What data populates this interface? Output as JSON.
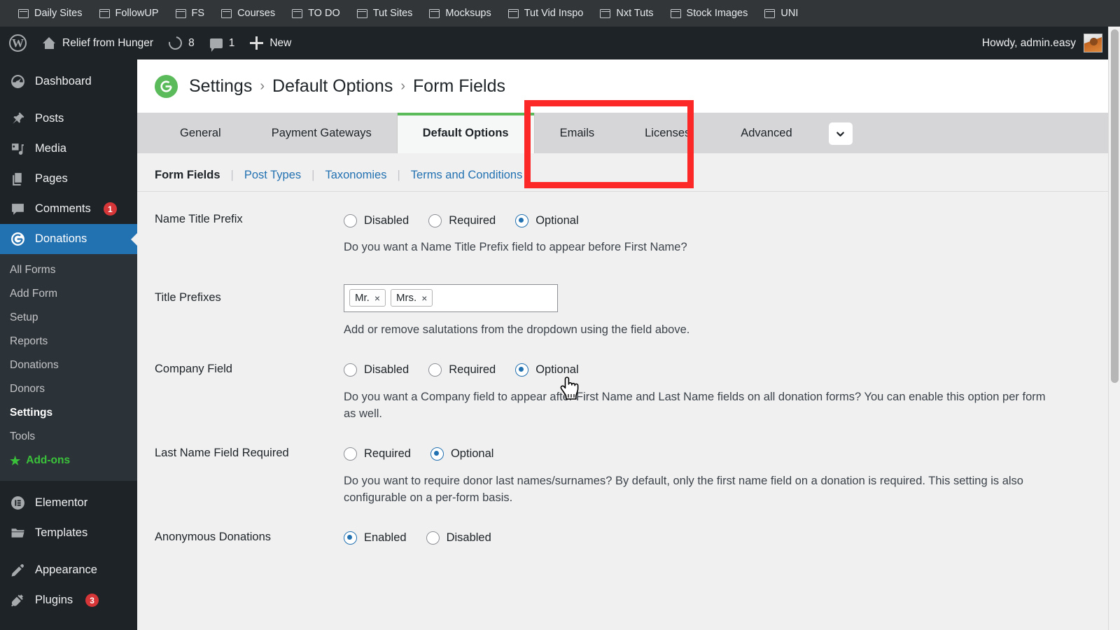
{
  "bookmarks": [
    {
      "label": "Daily Sites",
      "icon": "folder-icon"
    },
    {
      "label": "FollowUP",
      "icon": "folder-icon"
    },
    {
      "label": "FS",
      "icon": "folder-icon"
    },
    {
      "label": "Courses",
      "icon": "folder-icon"
    },
    {
      "label": "TO DO",
      "icon": "folder-icon"
    },
    {
      "label": "Tut Sites",
      "icon": "folder-icon"
    },
    {
      "label": "Mocksups",
      "icon": "folder-icon"
    },
    {
      "label": "Tut Vid Inspo",
      "icon": "folder-icon"
    },
    {
      "label": "Nxt Tuts",
      "icon": "folder-icon"
    },
    {
      "label": "Stock Images",
      "icon": "folder-icon"
    },
    {
      "label": "UNI",
      "icon": "folder-icon"
    }
  ],
  "adminbar": {
    "wp_logo": "W",
    "site_name": "Relief from Hunger",
    "updates_count": "8",
    "comments_count": "1",
    "new_label": "New",
    "howdy": "Howdy, admin.easy"
  },
  "sidebar": {
    "top_items": [
      {
        "label": "Dashboard",
        "icon": "dashboard-icon",
        "badge": null,
        "active": false
      },
      {
        "label": "Posts",
        "icon": "pin-icon",
        "badge": null,
        "active": false
      },
      {
        "label": "Media",
        "icon": "media-icon",
        "badge": null,
        "active": false
      },
      {
        "label": "Pages",
        "icon": "pages-icon",
        "badge": null,
        "active": false
      },
      {
        "label": "Comments",
        "icon": "comment-icon",
        "badge": "1",
        "active": false
      },
      {
        "label": "Donations",
        "icon": "give-icon",
        "badge": null,
        "active": true
      }
    ],
    "submenu": [
      {
        "label": "All Forms",
        "current": false,
        "addons": false
      },
      {
        "label": "Add Form",
        "current": false,
        "addons": false
      },
      {
        "label": "Setup",
        "current": false,
        "addons": false
      },
      {
        "label": "Reports",
        "current": false,
        "addons": false
      },
      {
        "label": "Donations",
        "current": false,
        "addons": false
      },
      {
        "label": "Donors",
        "current": false,
        "addons": false
      },
      {
        "label": "Settings",
        "current": true,
        "addons": false
      },
      {
        "label": "Tools",
        "current": false,
        "addons": false
      },
      {
        "label": "Add-ons",
        "current": false,
        "addons": true
      }
    ],
    "bottom_items": [
      {
        "label": "Elementor",
        "icon": "elementor-icon",
        "badge": null,
        "active": false
      },
      {
        "label": "Templates",
        "icon": "folder-open-icon",
        "badge": null,
        "active": false
      },
      {
        "label": "Appearance",
        "icon": "brush-icon",
        "badge": null,
        "active": false
      },
      {
        "label": "Plugins",
        "icon": "plug-icon",
        "badge": "3",
        "active": false
      }
    ]
  },
  "page_header": {
    "logo_icon": "give-logo-icon",
    "breadcrumb": [
      "Settings",
      "Default Options",
      "Form Fields"
    ],
    "separator": "›"
  },
  "tabs": [
    {
      "label": "General",
      "active": false
    },
    {
      "label": "Payment Gateways",
      "active": false
    },
    {
      "label": "Default Options",
      "active": true
    },
    {
      "label": "Emails",
      "active": false
    },
    {
      "label": "Licenses",
      "active": false
    },
    {
      "label": "Advanced",
      "active": false
    }
  ],
  "tab_more_icon": "chevron-down-icon",
  "sub_nav": [
    {
      "label": "Form Fields",
      "current": true
    },
    {
      "label": "Post Types",
      "current": false
    },
    {
      "label": "Taxonomies",
      "current": false
    },
    {
      "label": "Terms and Conditions",
      "current": false
    }
  ],
  "settings": [
    {
      "name": "name-title-prefix",
      "label": "Name Title Prefix",
      "type": "radio",
      "options": [
        {
          "label": "Disabled",
          "checked": false
        },
        {
          "label": "Required",
          "checked": false
        },
        {
          "label": "Optional",
          "checked": true
        }
      ],
      "description": "Do you want a Name Title Prefix field to appear before First Name?"
    },
    {
      "name": "title-prefixes",
      "label": "Title Prefixes",
      "type": "tags",
      "tags": [
        {
          "label": "Mr.",
          "remove": "×"
        },
        {
          "label": "Mrs.",
          "remove": "×"
        }
      ],
      "description": "Add or remove salutations from the dropdown using the field above."
    },
    {
      "name": "company-field",
      "label": "Company Field",
      "type": "radio",
      "options": [
        {
          "label": "Disabled",
          "checked": false
        },
        {
          "label": "Required",
          "checked": false
        },
        {
          "label": "Optional",
          "checked": true
        }
      ],
      "description": "Do you want a Company field to appear after First Name and Last Name fields on all donation forms? You can enable this option per form as well."
    },
    {
      "name": "last-name-field-required",
      "label": "Last Name Field Required",
      "type": "radio",
      "options": [
        {
          "label": "Required",
          "checked": false
        },
        {
          "label": "Optional",
          "checked": true
        }
      ],
      "description": "Do you want to require donor last names/surnames? By default, only the first name field on a donation is required. This setting is also configurable on a per-form basis."
    },
    {
      "name": "anonymous-donations",
      "label": "Anonymous Donations",
      "type": "radio",
      "options": [
        {
          "label": "Enabled",
          "checked": true
        },
        {
          "label": "Disabled",
          "checked": false
        }
      ],
      "description": ""
    }
  ],
  "colors": {
    "highlight_red": "#fc2828",
    "accent_green": "#5bbb5b",
    "accent_blue": "#2271b1",
    "badge_red": "#d63638",
    "admin_dark": "#1d2327"
  }
}
